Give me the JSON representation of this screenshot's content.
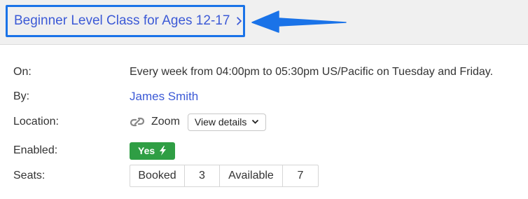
{
  "header": {
    "title": "Beginner Level Class for Ages 12-17",
    "chevron_icon": "chevron-right-icon",
    "pointer_arrow_color": "#1a73e8"
  },
  "details": {
    "on": {
      "label": "On:",
      "value": "Every week from 04:00pm to 05:30pm US/Pacific on Tuesday and Friday."
    },
    "by": {
      "label": "By:",
      "value": "James Smith"
    },
    "location": {
      "label": "Location:",
      "icon": "link-icon",
      "value": "Zoom",
      "button_label": "View details"
    },
    "enabled": {
      "label": "Enabled:",
      "badge_label": "Yes",
      "badge_icon": "lightning-icon",
      "badge_color": "#2f9e44"
    },
    "seats": {
      "label": "Seats:",
      "booked_label": "Booked",
      "booked_count": "3",
      "available_label": "Available",
      "available_count": "7"
    }
  },
  "colors": {
    "link": "#3c5ad6",
    "header_bg": "#f0f0f0"
  }
}
